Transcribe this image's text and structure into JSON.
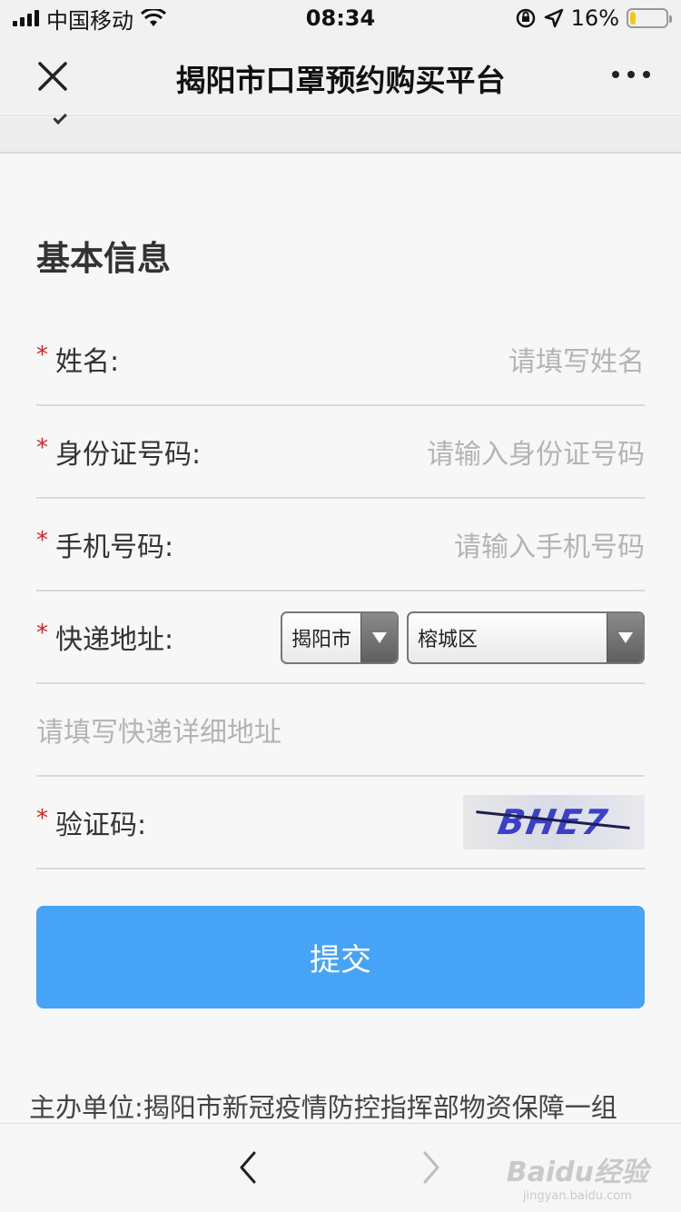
{
  "status_bar": {
    "carrier": "中国移动",
    "time": "08:34",
    "battery_percent": "16%",
    "battery_level": 0.16,
    "icons": [
      "signal-icon",
      "wifi-icon",
      "rotation-lock-icon",
      "location-icon",
      "battery-icon"
    ]
  },
  "nav": {
    "title": "揭阳市口罩预约购买平台",
    "close_icon": "close-icon",
    "more_icon": "more-icon"
  },
  "form": {
    "section_title": "基本信息",
    "required_mark": "*",
    "name": {
      "label": "姓名:",
      "placeholder": "请填写姓名"
    },
    "id_number": {
      "label": "身份证号码:",
      "placeholder": "请输入身份证号码"
    },
    "phone": {
      "label": "手机号码:",
      "placeholder": "请输入手机号码"
    },
    "address": {
      "label": "快递地址:",
      "city_selected": "揭阳市",
      "district_selected": "榕城区",
      "detail_placeholder": "请填写快递详细地址"
    },
    "captcha": {
      "label": "验证码:",
      "image_text": "BHE7"
    },
    "submit_label": "提交"
  },
  "footer": {
    "organizer": "主办单位:揭阳市新冠疫情防控指挥部物资保障一组"
  },
  "toolbar": {
    "back_icon": "chevron-left-icon",
    "forward_icon": "chevron-right-icon",
    "watermark_main": "Baidu经验",
    "watermark_sub": "jingyan.baidu.com"
  },
  "colors": {
    "accent": "#47a3f5",
    "required": "#e02020",
    "placeholder": "#b4b4b4"
  }
}
